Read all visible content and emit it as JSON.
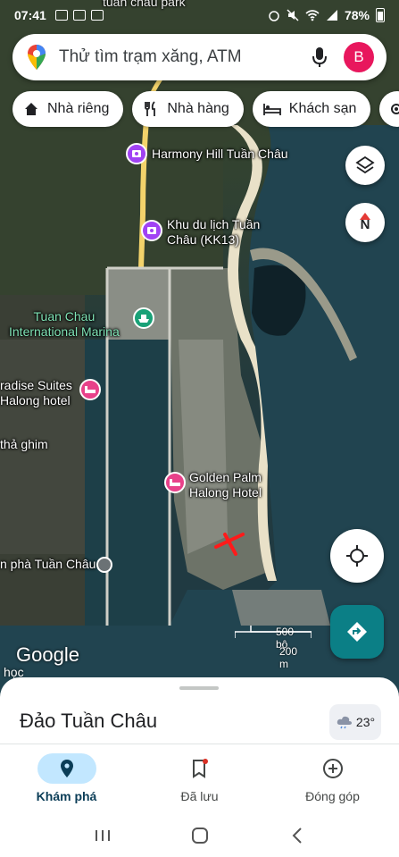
{
  "status_bar": {
    "time": "07:41",
    "battery": "78%"
  },
  "search": {
    "placeholder": "Thử tìm trạm xăng, ATM",
    "avatar_letter": "B"
  },
  "chips": [
    {
      "label": "Nhà riêng",
      "icon": "home-icon"
    },
    {
      "label": "Nhà hàng",
      "icon": "restaurant-icon"
    },
    {
      "label": "Khách sạn",
      "icon": "hotel-icon"
    }
  ],
  "map": {
    "labels": {
      "top_partial": "tuần châu park",
      "harmony": "Harmony Hill Tuần Châu",
      "khu_du_lich": "Khu du lịch Tuần\nChâu (KK13)",
      "marina": "Tuan Chau\nInternational Marina",
      "paradise": "radise Suites\nHalong hotel",
      "tha_ghim": "thả ghim",
      "golden_palm": "Golden Palm\nHalong Hotel",
      "ben_pha": "n phà Tuần Châu",
      "hoc": "học"
    },
    "compass_letter": "N",
    "attribution": "Google",
    "scale": {
      "top": "500 bộ",
      "bottom": "200 m"
    },
    "colors": {
      "accent": "#0b7f86",
      "avatar": "#e8175d",
      "purple_pin": "#a142f4",
      "pink_pin": "#e8418a",
      "teal_pin": "#19a177",
      "marker": "#ff1a1a"
    }
  },
  "sheet": {
    "title": "Đảo Tuần Châu",
    "temperature": "23°"
  },
  "nav": [
    {
      "label": "Khám phá",
      "icon": "explore-pin-icon",
      "active": true
    },
    {
      "label": "Đã lưu",
      "icon": "bookmark-icon",
      "active": false
    },
    {
      "label": "Đóng góp",
      "icon": "add-circle-icon",
      "active": false
    }
  ]
}
